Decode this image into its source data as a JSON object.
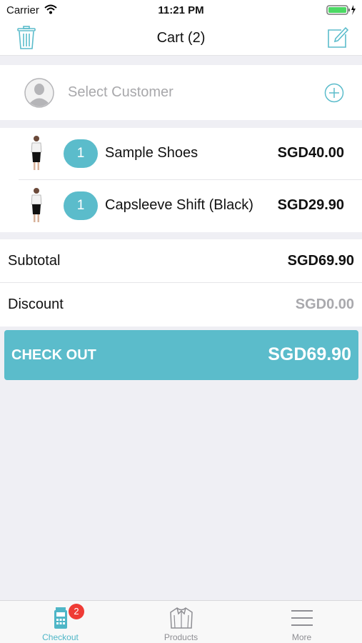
{
  "status_bar": {
    "carrier": "Carrier",
    "time": "11:21 PM"
  },
  "nav": {
    "title": "Cart (2)"
  },
  "customer": {
    "placeholder": "Select Customer"
  },
  "items": [
    {
      "qty": "1",
      "name": "Sample Shoes",
      "price": "SGD40.00"
    },
    {
      "qty": "1",
      "name": "Capsleeve Shift (Black)",
      "price": "SGD29.90"
    }
  ],
  "totals": {
    "subtotal_label": "Subtotal",
    "subtotal_value": "SGD69.90",
    "discount_label": "Discount",
    "discount_value": "SGD0.00"
  },
  "checkout": {
    "label": "CHECK OUT",
    "total": "SGD69.90"
  },
  "tabs": [
    {
      "label": "Checkout",
      "badge": "2",
      "icon": "terminal-icon",
      "active": true
    },
    {
      "label": "Products",
      "icon": "shirt-icon",
      "active": false
    },
    {
      "label": "More",
      "icon": "menu-icon",
      "active": false
    }
  ],
  "colors": {
    "accent": "#5bbccb",
    "badge": "#ef3b35",
    "background": "#efeff4"
  }
}
